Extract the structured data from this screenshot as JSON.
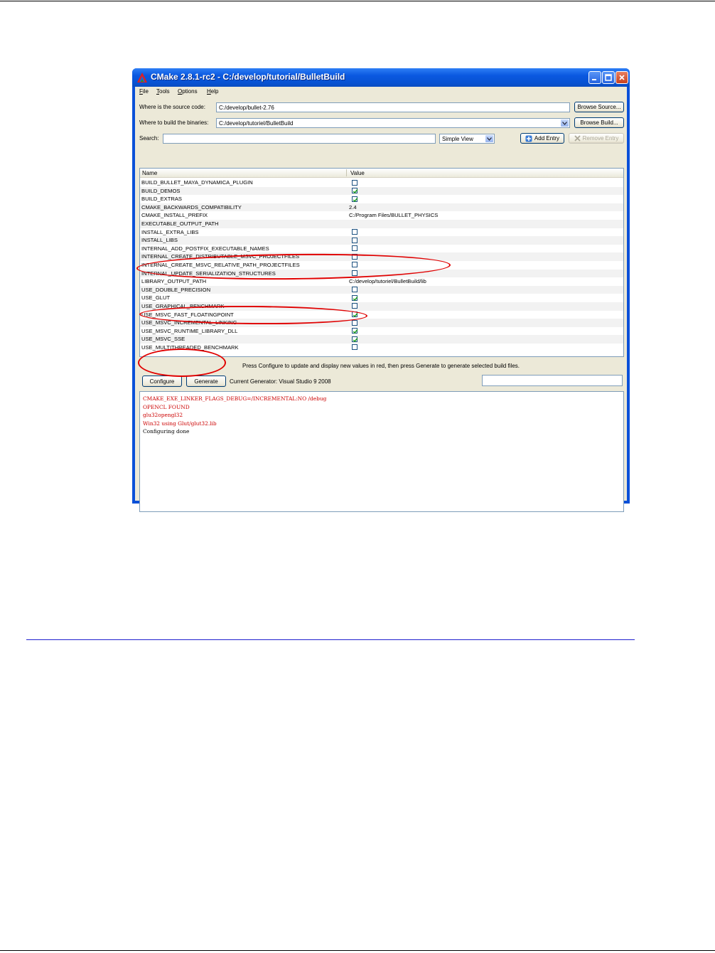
{
  "window": {
    "title": "CMake 2.8.1-rc2 - C:/develop/tutorial/BulletBuild",
    "icons": {
      "app": "cmake-triangle-icon",
      "minimize": "minimize-icon",
      "maximize": "maximize-icon",
      "close": "close-icon"
    }
  },
  "menu": [
    "File",
    "Tools",
    "Options",
    "Help"
  ],
  "source": {
    "label": "Where is the source code:",
    "value": "C:/develop/bullet-2.76",
    "browse": "Browse Source..."
  },
  "build": {
    "label": "Where to build the binaries:",
    "value": "C:/develop/tutoriel/BulletBuild",
    "browse": "Browse Build..."
  },
  "search": {
    "label": "Search:",
    "value": ""
  },
  "view_select": {
    "value": "Simple View"
  },
  "add_entry": "Add Entry",
  "remove_entry": "Remove Entry",
  "table": {
    "headers": [
      "Name",
      "Value"
    ],
    "rows": [
      {
        "name": "BUILD_BULLET_MAYA_DYNAMICA_PLUGIN",
        "type": "bool",
        "checked": false
      },
      {
        "name": "BUILD_DEMOS",
        "type": "bool",
        "checked": true
      },
      {
        "name": "BUILD_EXTRAS",
        "type": "bool",
        "checked": true
      },
      {
        "name": "CMAKE_BACKWARDS_COMPATIBILITY",
        "type": "text",
        "value": "2.4"
      },
      {
        "name": "CMAKE_INSTALL_PREFIX",
        "type": "text",
        "value": "C:/Program Files/BULLET_PHYSICS"
      },
      {
        "name": "EXECUTABLE_OUTPUT_PATH",
        "type": "text",
        "value": ""
      },
      {
        "name": "INSTALL_EXTRA_LIBS",
        "type": "bool",
        "checked": false
      },
      {
        "name": "INSTALL_LIBS",
        "type": "bool",
        "checked": false
      },
      {
        "name": "INTERNAL_ADD_POSTFIX_EXECUTABLE_NAMES",
        "type": "bool",
        "checked": false
      },
      {
        "name": "INTERNAL_CREATE_DISTRIBUTABLE_MSVC_PROJECTFILES",
        "type": "bool",
        "checked": false
      },
      {
        "name": "INTERNAL_CREATE_MSVC_RELATIVE_PATH_PROJECTFILES",
        "type": "bool",
        "checked": false
      },
      {
        "name": "INTERNAL_UPDATE_SERIALIZATION_STRUCTURES",
        "type": "bool",
        "checked": false
      },
      {
        "name": "LIBRARY_OUTPUT_PATH",
        "type": "text",
        "value": "C:/develop/tutoriel/BulletBuild/lib"
      },
      {
        "name": "USE_DOUBLE_PRECISION",
        "type": "bool",
        "checked": false
      },
      {
        "name": "USE_GLUT",
        "type": "bool",
        "checked": true
      },
      {
        "name": "USE_GRAPHICAL_BENCHMARK",
        "type": "bool",
        "checked": false
      },
      {
        "name": "USE_MSVC_FAST_FLOATINGPOINT",
        "type": "bool",
        "checked": true
      },
      {
        "name": "USE_MSVC_INCREMENTAL_LINKING",
        "type": "bool",
        "checked": false
      },
      {
        "name": "USE_MSVC_RUNTIME_LIBRARY_DLL",
        "type": "bool",
        "checked": true
      },
      {
        "name": "USE_MSVC_SSE",
        "type": "bool",
        "checked": true
      },
      {
        "name": "USE_MULTITHREADED_BENCHMARK",
        "type": "bool",
        "checked": false
      }
    ]
  },
  "hint": "Press Configure to update and display new values in red, then press Generate to generate selected build files.",
  "configure": "Configure",
  "generate": "Generate",
  "generator": "Current Generator: Visual Studio 9 2008",
  "output": [
    {
      "text": "CMAKE_EXE_LINKER_FLAGS_DEBUG=/INCREMENTAL:NO /debug",
      "color": "red"
    },
    {
      "text": "OPENCL FOUND",
      "color": "red"
    },
    {
      "text": "glu32opengl32",
      "color": "red"
    },
    {
      "text": "Win32 using Glut/glut32.lib",
      "color": "red"
    },
    {
      "text": "Configuring done",
      "color": "black"
    }
  ],
  "annotation_color": "#e00000"
}
